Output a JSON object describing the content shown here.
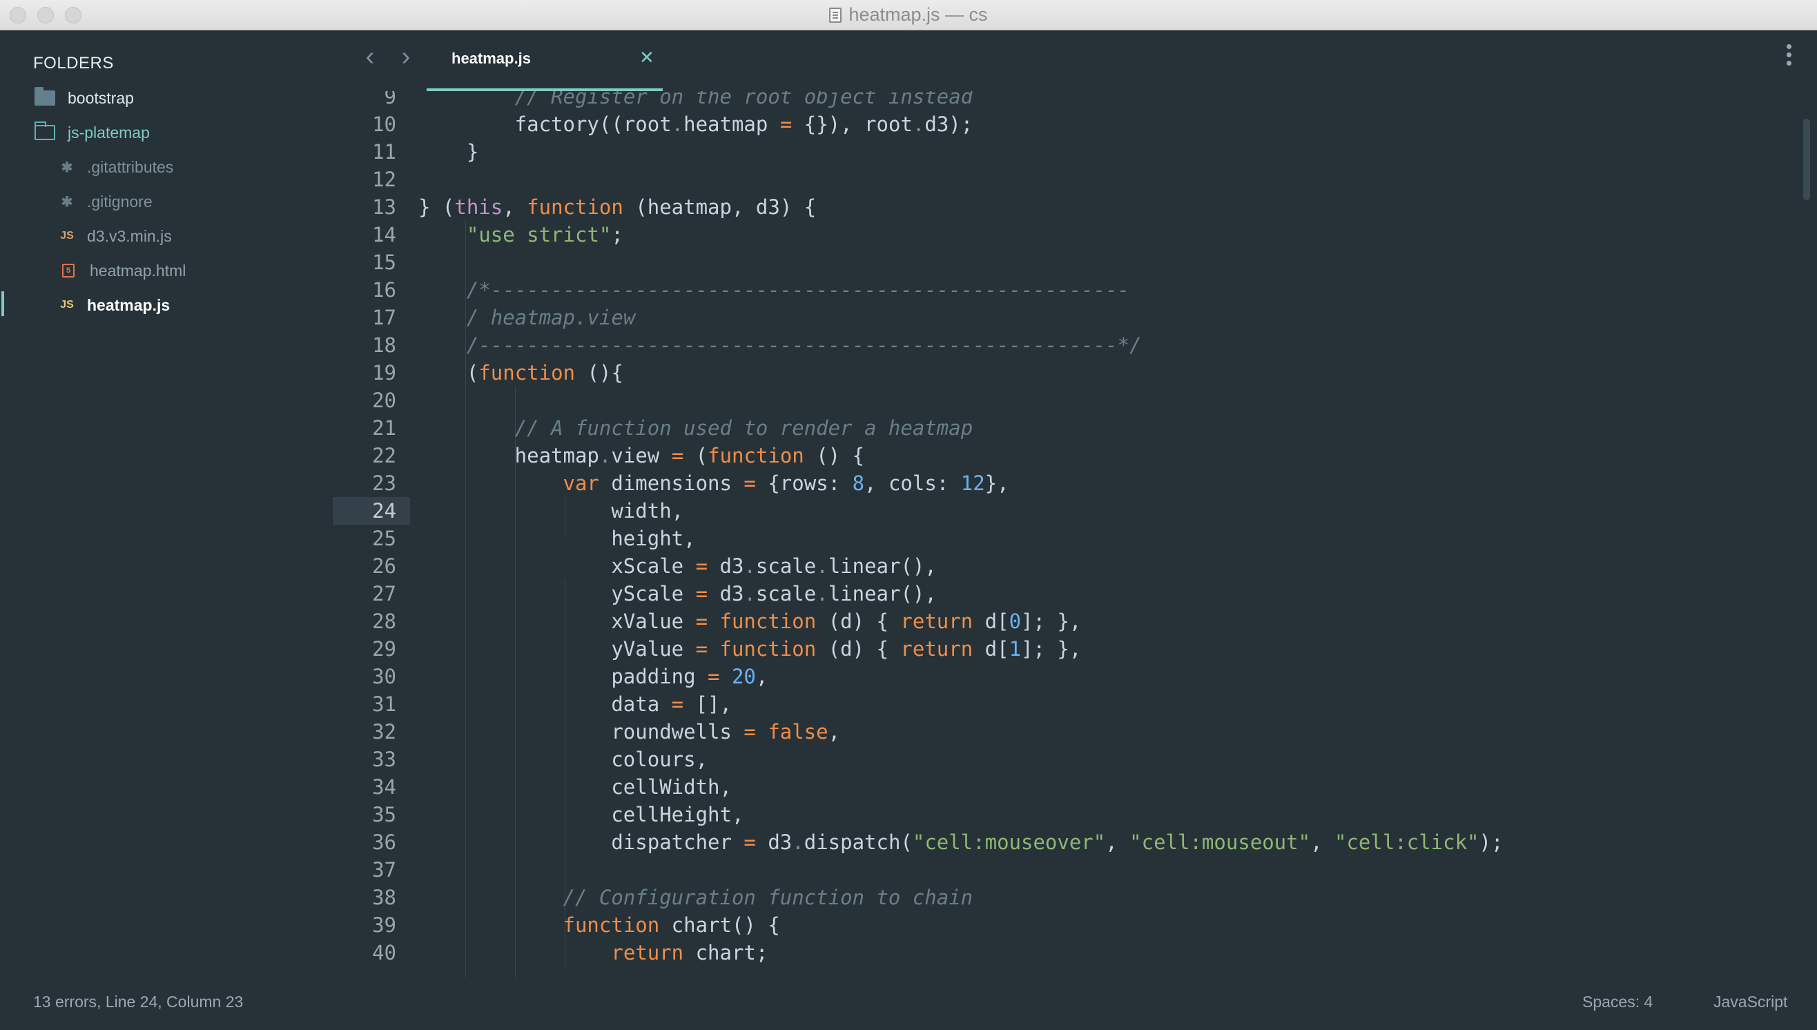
{
  "window": {
    "title": "heatmap.js — cs"
  },
  "sidebar": {
    "title": "FOLDERS",
    "items": [
      {
        "label": "bootstrap",
        "type": "folder",
        "icon": "folder-icon"
      },
      {
        "label": "js-platemap",
        "type": "folder-open",
        "icon": "folder-open-icon"
      },
      {
        "label": ".gitattributes",
        "type": "file",
        "icon": "asterisk-icon",
        "glyph": "✱"
      },
      {
        "label": ".gitignore",
        "type": "file",
        "icon": "asterisk-icon",
        "glyph": "✱"
      },
      {
        "label": "d3.v3.min.js",
        "type": "file",
        "icon": "js-file-icon",
        "glyph": "JS"
      },
      {
        "label": "heatmap.html",
        "type": "file",
        "icon": "html-file-icon",
        "glyph": "5"
      },
      {
        "label": "heatmap.js",
        "type": "file",
        "icon": "js-file-icon",
        "glyph": "JS",
        "active": true
      }
    ]
  },
  "tabs": [
    {
      "label": "heatmap.js",
      "close": "✕",
      "active": true
    }
  ],
  "nav": {
    "back": "‹",
    "forward": "›"
  },
  "editor": {
    "current_line": "24",
    "lines": [
      {
        "n": "9",
        "html": "        <span class=\"c\">// Register on the root object instead</span>"
      },
      {
        "n": "10",
        "html": "        factory((root<span class=\"d\">.</span>heatmap <span class=\"o\">=</span> {}), root<span class=\"d\">.</span>d3);"
      },
      {
        "n": "11",
        "html": "    }"
      },
      {
        "n": "12",
        "html": ""
      },
      {
        "n": "13",
        "html": "} (<span class=\"t\">this</span>, <span class=\"k\">function</span> (heatmap, d3) {"
      },
      {
        "n": "14",
        "html": "    <span class=\"s\">\"use strict\"</span>;"
      },
      {
        "n": "15",
        "html": ""
      },
      {
        "n": "16",
        "html": "    <span class=\"c\">/*-----------------------------------------------------</span>"
      },
      {
        "n": "17",
        "html": "    <span class=\"c\">/ heatmap.view</span>"
      },
      {
        "n": "18",
        "html": "    <span class=\"c\">/-----------------------------------------------------*/</span>"
      },
      {
        "n": "19",
        "html": "    (<span class=\"k\">function</span> (){"
      },
      {
        "n": "20",
        "html": ""
      },
      {
        "n": "21",
        "html": "        <span class=\"c\">// A function used to render a heatmap</span>"
      },
      {
        "n": "22",
        "html": "        heatmap<span class=\"d\">.</span>view <span class=\"o\">=</span> (<span class=\"k\">function</span> () {"
      },
      {
        "n": "23",
        "html": "            <span class=\"k\">var</span> dimensions <span class=\"o\">=</span> {rows: <span class=\"n\">8</span>, cols: <span class=\"n\">12</span>},"
      },
      {
        "n": "24",
        "html": "                width,"
      },
      {
        "n": "25",
        "html": "                height,"
      },
      {
        "n": "26",
        "html": "                xScale <span class=\"o\">=</span> d3<span class=\"d\">.</span>scale<span class=\"d\">.</span>linear(),"
      },
      {
        "n": "27",
        "html": "                yScale <span class=\"o\">=</span> d3<span class=\"d\">.</span>scale<span class=\"d\">.</span>linear(),"
      },
      {
        "n": "28",
        "html": "                xValue <span class=\"o\">=</span> <span class=\"k\">function</span> (d) { <span class=\"k\">return</span> d[<span class=\"n\">0</span>]; },"
      },
      {
        "n": "29",
        "html": "                yValue <span class=\"o\">=</span> <span class=\"k\">function</span> (d) { <span class=\"k\">return</span> d[<span class=\"n\">1</span>]; },"
      },
      {
        "n": "30",
        "html": "                padding <span class=\"o\">=</span> <span class=\"n\">20</span>,"
      },
      {
        "n": "31",
        "html": "                data <span class=\"o\">=</span> [],"
      },
      {
        "n": "32",
        "html": "                roundwells <span class=\"o\">=</span> <span class=\"k\">false</span>,"
      },
      {
        "n": "33",
        "html": "                colours,"
      },
      {
        "n": "34",
        "html": "                cellWidth,"
      },
      {
        "n": "35",
        "html": "                cellHeight,"
      },
      {
        "n": "36",
        "html": "                dispatcher <span class=\"o\">=</span> d3<span class=\"d\">.</span>dispatch(<span class=\"s\">\"cell:mouseover\"</span>, <span class=\"s\">\"cell:mouseout\"</span>, <span class=\"s\">\"cell:click\"</span>);"
      },
      {
        "n": "37",
        "html": ""
      },
      {
        "n": "38",
        "html": "            <span class=\"c\">// Configuration function to chain</span>"
      },
      {
        "n": "39",
        "html": "            <span class=\"k\">function</span> chart() {"
      },
      {
        "n": "40",
        "html": "                <span class=\"k\">return</span> chart;"
      }
    ]
  },
  "status": {
    "left": "13 errors, Line 24, Column 23",
    "spaces": "Spaces: 4",
    "syntax": "JavaScript"
  },
  "colors": {
    "background": "#263238",
    "accent": "#80cbc4",
    "keyword": "#f08d49",
    "string": "#8fb773",
    "number": "#6ab0f3",
    "comment": "#6b7e87"
  }
}
